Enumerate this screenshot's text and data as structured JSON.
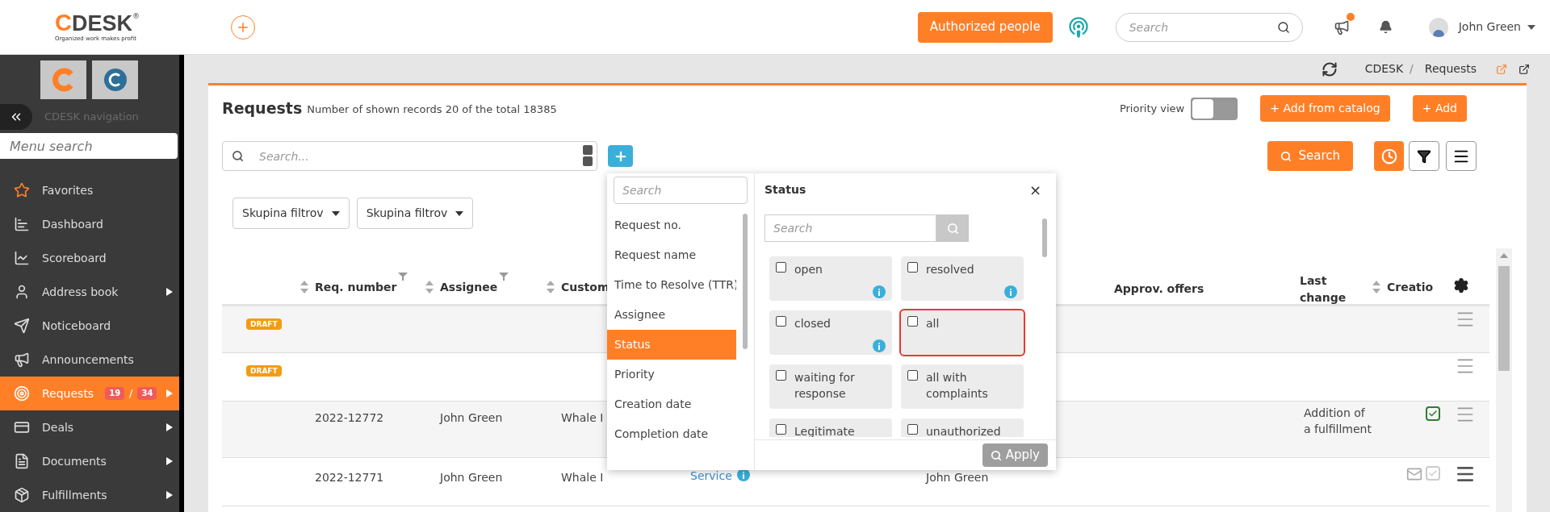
{
  "header": {
    "logo_mark": "C",
    "logo_word": "DESK",
    "logo_reg": "®",
    "logo_tagline": "Organized work makes profit",
    "authorized_button": "Authorized people",
    "search_placeholder": "Search",
    "announcements_unread": true,
    "user_name": "John Green"
  },
  "sidebar": {
    "navigation_label": "CDESK navigation",
    "menu_search_placeholder": "Menu search",
    "items": [
      {
        "label": "Favorites",
        "selected": false,
        "submenu": false
      },
      {
        "label": "Dashboard",
        "selected": false,
        "submenu": false
      },
      {
        "label": "Scoreboard",
        "selected": false,
        "submenu": false
      },
      {
        "label": "Address book",
        "selected": false,
        "submenu": true
      },
      {
        "label": "Noticeboard",
        "selected": false,
        "submenu": false
      },
      {
        "label": "Announcements",
        "selected": false,
        "submenu": false
      },
      {
        "label": "Requests",
        "selected": true,
        "submenu": true,
        "badges": [
          "19",
          "/",
          "34"
        ]
      },
      {
        "label": "Deals",
        "selected": false,
        "submenu": true
      },
      {
        "label": "Documents",
        "selected": false,
        "submenu": true
      },
      {
        "label": "Fulfillments",
        "selected": false,
        "submenu": true
      }
    ]
  },
  "breadcrumb": {
    "items": [
      "CDESK",
      "Requests"
    ],
    "separator": "/"
  },
  "page": {
    "title": "Requests",
    "subtitle": "Number of shown records 20 of the total 18385",
    "priority_view": {
      "label": "Priority view",
      "on": false
    },
    "add_from_catalog_button": "+ Add from catalog",
    "add_button": "+ Add",
    "search_placeholder": "Search...",
    "search_button": "Search",
    "filter_groups": [
      "Skupina filtrov",
      "Skupina filtrov"
    ]
  },
  "columns_menu": {
    "search_placeholder": "Search",
    "items": [
      {
        "label": "Request no.",
        "selected": false
      },
      {
        "label": "Request name",
        "selected": false
      },
      {
        "label": "Time to Resolve (TTR)",
        "selected": false
      },
      {
        "label": "Assignee",
        "selected": false
      },
      {
        "label": "Status",
        "selected": true
      },
      {
        "label": "Priority",
        "selected": false
      },
      {
        "label": "Creation date",
        "selected": false
      },
      {
        "label": "Completion date",
        "selected": false
      }
    ]
  },
  "status_panel": {
    "title": "Status",
    "close": "×",
    "search_placeholder": "Search",
    "apply_button": {
      "label": "Apply",
      "disabled": true
    },
    "options": [
      {
        "label": "open",
        "checked": false,
        "info": true,
        "highlighted": false
      },
      {
        "label": "resolved",
        "checked": false,
        "info": true,
        "highlighted": false
      },
      {
        "label": "closed",
        "checked": false,
        "info": true,
        "highlighted": false
      },
      {
        "label": "all",
        "checked": false,
        "info": false,
        "highlighted": true
      },
      {
        "label": "waiting for response",
        "checked": false,
        "info": false,
        "highlighted": false
      },
      {
        "label": "all with complaints",
        "checked": false,
        "info": false,
        "highlighted": false
      },
      {
        "label": "Legitimate",
        "checked": false,
        "highlighted": false
      },
      {
        "label": "unauthorized",
        "checked": false,
        "highlighted": false
      }
    ]
  },
  "table": {
    "columns": [
      {
        "label": "Req. number",
        "sortable": true,
        "filter": true
      },
      {
        "label": "Assignee",
        "sortable": true,
        "filter": true
      },
      {
        "label": "Custom",
        "sortable": true,
        "filter": false
      },
      {
        "label": "Approv. offers",
        "sortable": false,
        "filter": false
      },
      {
        "label": "Last change",
        "sortable": false,
        "filter": false
      },
      {
        "label": "Creatio",
        "sortable": true,
        "filter": false
      }
    ],
    "rows": [
      {
        "badge": "DRAFT"
      },
      {
        "badge": "DRAFT"
      },
      {
        "req_number": "2022-12772",
        "assignee": "John Green",
        "customer": "Whale I",
        "last_change": "Addition of a fulfillment",
        "approved": true
      },
      {
        "req_number": "2022-12771",
        "assignee": "John Green",
        "customer": "Whale I",
        "type": "Service",
        "approver": "John Green",
        "approved": false,
        "mail": true
      }
    ]
  }
}
